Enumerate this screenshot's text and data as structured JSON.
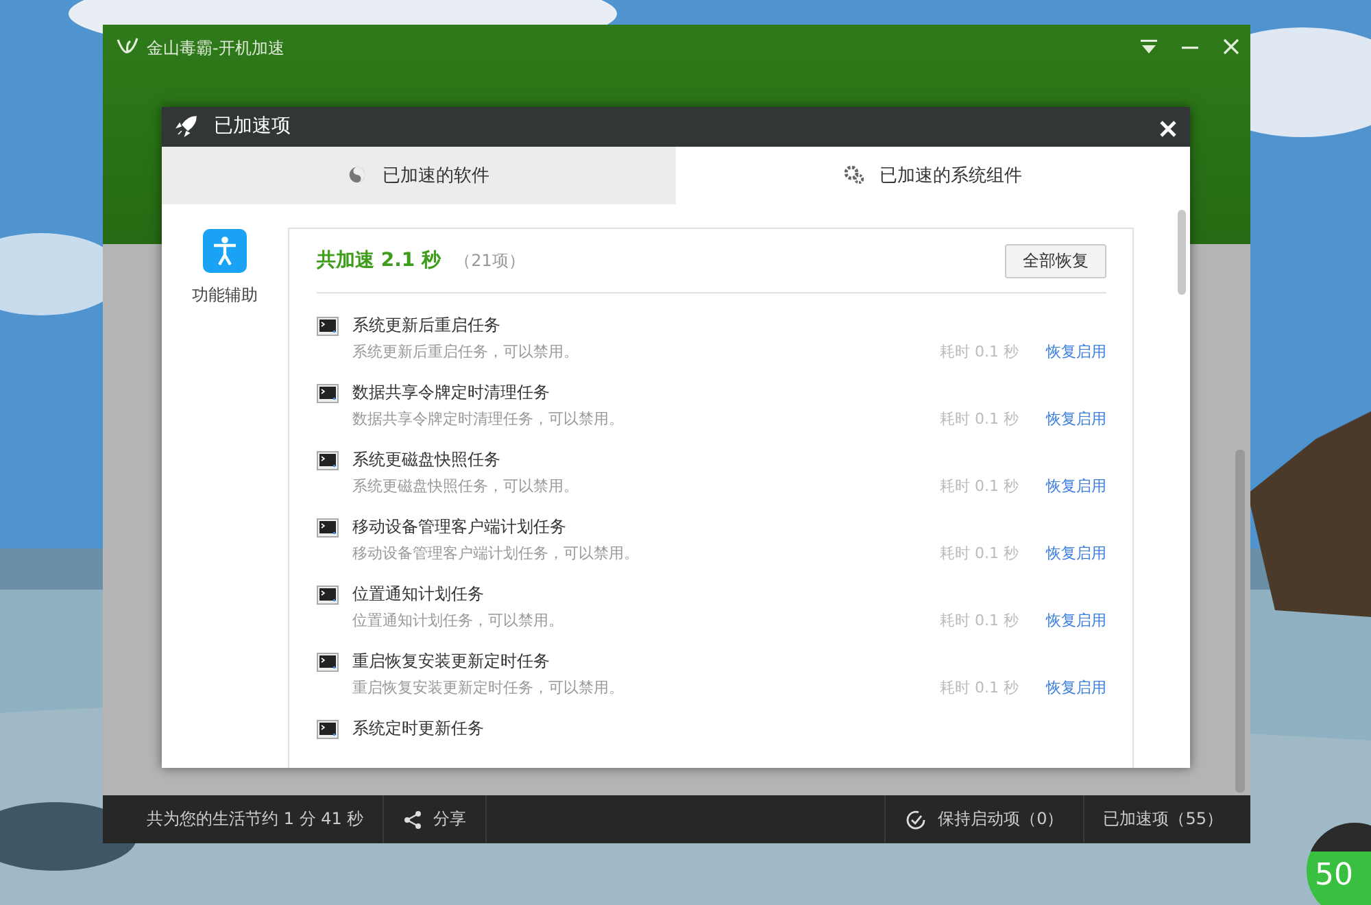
{
  "app": {
    "title": "金山毒霸-开机加速"
  },
  "dialog": {
    "title": "已加速项"
  },
  "tabs": [
    {
      "label": "已加速的软件",
      "selected": false,
      "kind": "software"
    },
    {
      "label": "已加速的系统组件",
      "selected": true,
      "kind": "system"
    }
  ],
  "category": {
    "label": "功能辅助"
  },
  "summary": {
    "title": "共加速 2.1 秒",
    "count": "（21项）",
    "restore_all": "全部恢复"
  },
  "items": [
    {
      "name": "系统更新后重启任务",
      "desc": "系统更新后重启任务，可以禁用。",
      "time": "耗时 0.1 秒",
      "action": "恢复启用"
    },
    {
      "name": "数据共享令牌定时清理任务",
      "desc": "数据共享令牌定时清理任务，可以禁用。",
      "time": "耗时 0.1 秒",
      "action": "恢复启用"
    },
    {
      "name": "系统更磁盘快照任务",
      "desc": "系统更磁盘快照任务，可以禁用。",
      "time": "耗时 0.1 秒",
      "action": "恢复启用"
    },
    {
      "name": "移动设备管理客户端计划任务",
      "desc": "移动设备管理客户端计划任务，可以禁用。",
      "time": "耗时 0.1 秒",
      "action": "恢复启用"
    },
    {
      "name": "位置通知计划任务",
      "desc": "位置通知计划任务，可以禁用。",
      "time": "耗时 0.1 秒",
      "action": "恢复启用"
    },
    {
      "name": "重启恢复安装更新定时任务",
      "desc": "重启恢复安装更新定时任务，可以禁用。",
      "time": "耗时 0.1 秒",
      "action": "恢复启用"
    },
    {
      "name": "系统定时更新任务"
    }
  ],
  "status_bar": {
    "saved": "共为您的生活节约 1 分 41 秒",
    "share": "分享",
    "kept": "保持启动项（0）",
    "accelerated": "已加速项（55）"
  },
  "badge": {
    "text": "50"
  }
}
